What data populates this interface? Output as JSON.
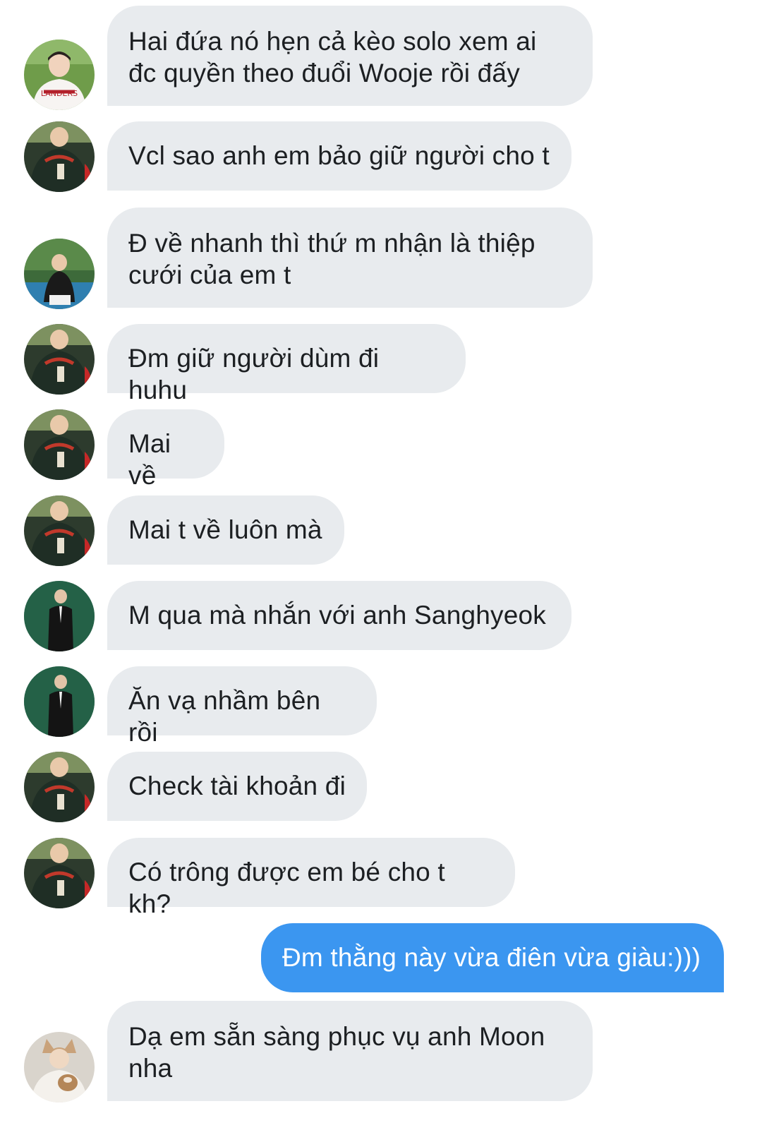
{
  "colors": {
    "received_bubble": "#e8ebee",
    "sent_bubble": "#3b96f0",
    "received_text": "#1c1f22",
    "sent_text": "#ffffff"
  },
  "messages": [
    {
      "direction": "received",
      "avatar": "avatar-baseball-jersey",
      "text": "Hai đứa nó hẹn cả kèo solo xem ai\nđc quyền theo đuổi Wooje rồi đấy"
    },
    {
      "direction": "received",
      "avatar": "avatar-green-jacket",
      "text": "Vcl sao anh em bảo giữ người cho t"
    },
    {
      "direction": "received",
      "avatar": "avatar-outdoor-crouch",
      "text": "Đ về nhanh thì thứ m nhận là thiệp\ncưới của em t"
    },
    {
      "direction": "received",
      "avatar": "avatar-green-jacket",
      "text": "Đm giữ người dùm đi huhu"
    },
    {
      "direction": "received",
      "avatar": "avatar-green-jacket",
      "text": "Mai về"
    },
    {
      "direction": "received",
      "avatar": "avatar-green-jacket",
      "text": "Mai t về luôn mà"
    },
    {
      "direction": "received",
      "avatar": "avatar-black-suit",
      "text": "M qua mà nhắn với anh Sanghyeok"
    },
    {
      "direction": "received",
      "avatar": "avatar-black-suit",
      "text": "Ăn vạ nhầm bên rồi"
    },
    {
      "direction": "received",
      "avatar": "avatar-green-jacket",
      "text": "Check tài khoản đi"
    },
    {
      "direction": "received",
      "avatar": "avatar-green-jacket",
      "text": "Có trông được em bé cho t kh?"
    },
    {
      "direction": "sent",
      "avatar": "",
      "text": "Đm thằng này vừa điên vừa giàu:)))"
    },
    {
      "direction": "received",
      "avatar": "avatar-cat-hat",
      "text": "Dạ em sẵn sàng phục vụ anh Moon\nnha"
    }
  ]
}
